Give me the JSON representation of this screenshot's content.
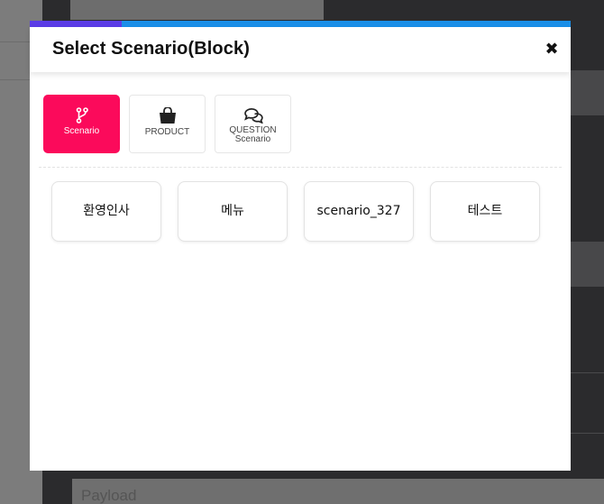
{
  "background": {
    "payload_placeholder": "Payload"
  },
  "modal": {
    "title": "Select Scenario(Block)",
    "close_icon": "close-icon",
    "progress_fraction": 0.17,
    "colors": {
      "accent": "#fb0a5b",
      "progress_bar": "#1a8fe8",
      "progress_fill": "#5b3ce6"
    }
  },
  "type_tabs": [
    {
      "label": "Scenario",
      "icon": "branch-icon",
      "active": true
    },
    {
      "label": "PRODUCT",
      "icon": "shopping-bag-icon",
      "active": false
    },
    {
      "label_line1": "QUESTION",
      "label_line2": "Scenario",
      "icon": "chat-bubbles-icon",
      "active": false
    }
  ],
  "scenarios": [
    {
      "label": "환영인사"
    },
    {
      "label": "메뉴"
    },
    {
      "label": "scenario_327"
    },
    {
      "label": "테스트"
    }
  ]
}
